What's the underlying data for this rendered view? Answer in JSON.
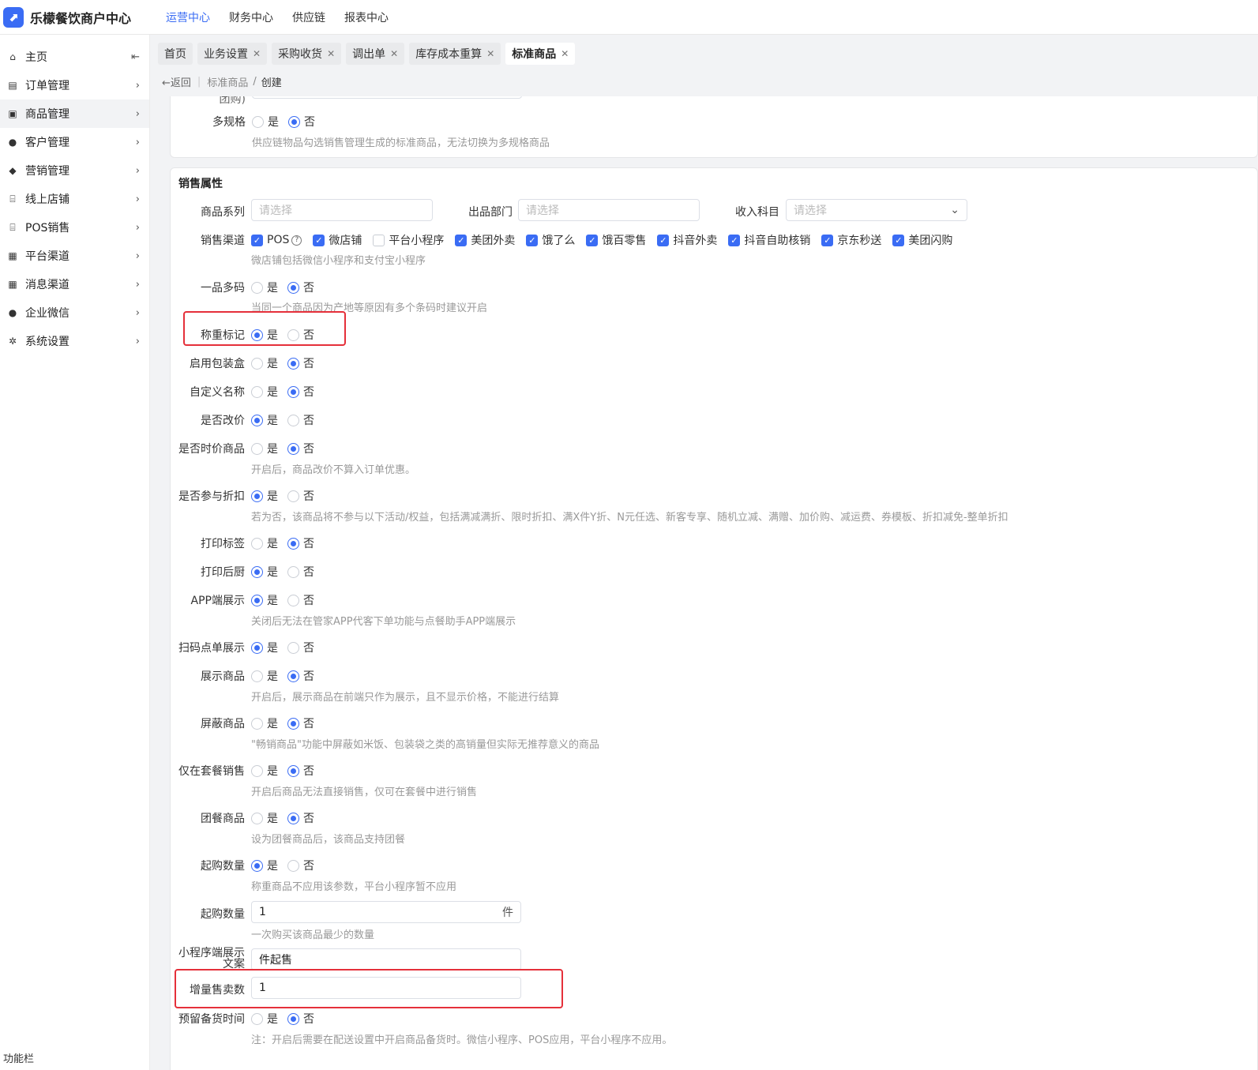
{
  "app": {
    "title": "乐檬餐饮商户中心"
  },
  "topnav": [
    "运营中心",
    "财务中心",
    "供应链",
    "报表中心"
  ],
  "sidebar": {
    "items": [
      {
        "label": "主页",
        "icon": "home-icon"
      },
      {
        "label": "订单管理",
        "icon": "order-icon"
      },
      {
        "label": "商品管理",
        "icon": "goods-icon"
      },
      {
        "label": "客户管理",
        "icon": "user-icon"
      },
      {
        "label": "营销管理",
        "icon": "tag-icon"
      },
      {
        "label": "线上店铺",
        "icon": "store-icon"
      },
      {
        "label": "POS销售",
        "icon": "store-icon"
      },
      {
        "label": "平台渠道",
        "icon": "channel-icon"
      },
      {
        "label": "消息渠道",
        "icon": "channel-icon"
      },
      {
        "label": "企业微信",
        "icon": "chat-icon"
      },
      {
        "label": "系统设置",
        "icon": "gear-icon"
      }
    ],
    "footer": "功能栏"
  },
  "tabs": [
    "首页",
    "业务设置",
    "采购收货",
    "调出单",
    "库存成本重算",
    "标准商品"
  ],
  "breadcrumb": {
    "back": "返回",
    "parent": "标准商品",
    "sep": "/",
    "current": "创建"
  },
  "card1": {
    "partial_label": "团购)",
    "multi_spec": {
      "label": "多规格",
      "hint": "供应链物品勾选销售管理生成的标准商品，无法切换为多规格商品"
    }
  },
  "radio": {
    "yes": "是",
    "no": "否"
  },
  "sales": {
    "title": "销售属性",
    "series": {
      "label": "商品系列",
      "placeholder": "请选择"
    },
    "dept": {
      "label": "出品部门",
      "placeholder": "请选择"
    },
    "income": {
      "label": "收入科目",
      "placeholder": "请选择"
    },
    "channels": {
      "label": "销售渠道",
      "hint": "微店铺包括微信小程序和支付宝小程序",
      "items": [
        "POS",
        "微店铺",
        "平台小程序",
        "美团外卖",
        "饿了么",
        "饿百零售",
        "抖音外卖",
        "抖音自助核销",
        "京东秒送",
        "美团闪购"
      ]
    },
    "multi_code": {
      "label": "一品多码",
      "hint": "当同一个商品因为产地等原因有多个条码时建议开启"
    },
    "weigh": {
      "label": "称重标记"
    },
    "package": {
      "label": "启用包装盒"
    },
    "custom_name": {
      "label": "自定义名称"
    },
    "change_price": {
      "label": "是否改价"
    },
    "time_price": {
      "label": "是否时价商品",
      "hint": "开启后，商品改价不算入订单优惠。"
    },
    "discount": {
      "label": "是否参与折扣",
      "hint": "若为否，该商品将不参与以下活动/权益，包括满减满折、限时折扣、满X件Y折、N元任选、新客专享、随机立减、满赠、加价购、减运费、券模板、折扣减免-整单折扣"
    },
    "print_label": {
      "label": "打印标签"
    },
    "print_kitchen": {
      "label": "打印后厨"
    },
    "app_show": {
      "label": "APP端展示",
      "hint": "关闭后无法在管家APP代客下单功能与点餐助手APP端展示"
    },
    "scan_show": {
      "label": "扫码点单展示"
    },
    "display": {
      "label": "展示商品",
      "hint": "开启后，展示商品在前端只作为展示，且不显示价格，不能进行结算"
    },
    "block": {
      "label": "屏蔽商品",
      "hint": "\"畅销商品\"功能中屏蔽如米饭、包装袋之类的高销量但实际无推荐意义的商品"
    },
    "combo_only": {
      "label": "仅在套餐销售",
      "hint": "开启后商品无法直接销售，仅可在套餐中进行销售"
    },
    "group_meal": {
      "label": "团餐商品",
      "hint": "设为团餐商品后，该商品支持团餐"
    },
    "min_qty_toggle": {
      "label": "起购数量",
      "hint": "称重商品不应用该参数，平台小程序暂不应用"
    },
    "min_qty": {
      "label": "起购数量",
      "value": "1",
      "unit": "件",
      "hint": "一次购买该商品最少的数量"
    },
    "mini_text": {
      "label_line1": "小程序端展示",
      "label_line2": "文案",
      "value": "件起售"
    },
    "increment": {
      "label": "增量售卖数",
      "value": "1"
    },
    "reserve": {
      "label": "预留备货时间",
      "hint": "注：开启后需要在配送设置中开启商品备货时。微信小程序、POS应用，平台小程序不应用。"
    }
  }
}
